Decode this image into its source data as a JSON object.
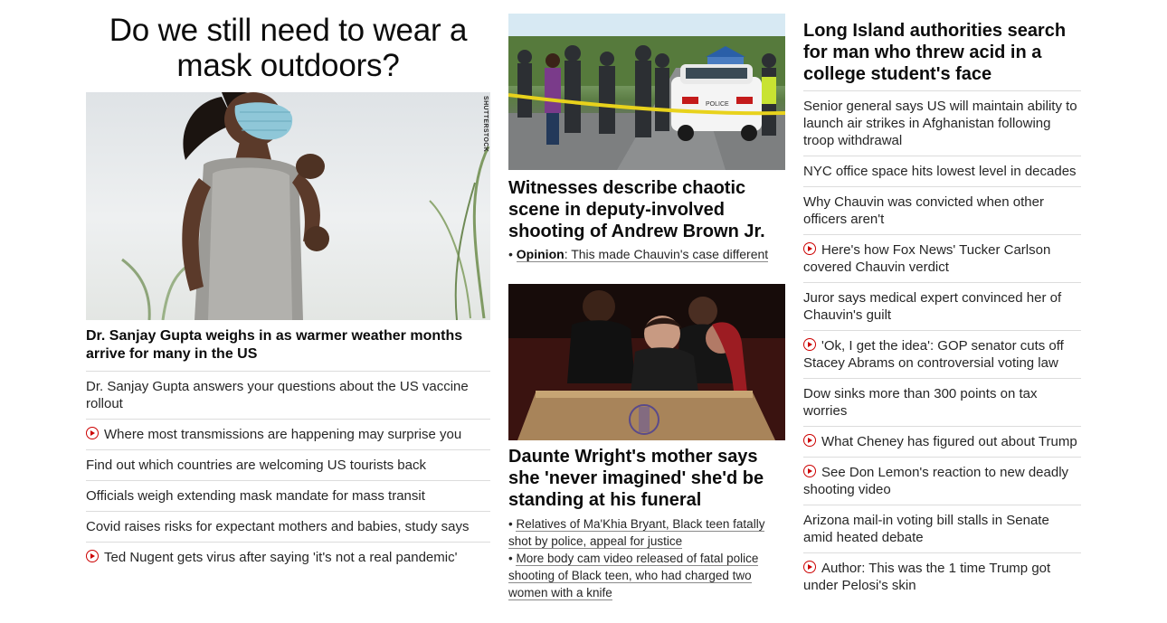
{
  "col1": {
    "headline": "Do we still need to wear a mask outdoors?",
    "image_credit": "SHUTTERSTOCK",
    "image_headline": "Dr. Sanjay Gupta weighs in as warmer weather months arrive for many in the US",
    "items": [
      {
        "text": "Dr. Sanjay Gupta answers your questions about the US vaccine rollout",
        "video": false
      },
      {
        "text": "Where most transmissions are happening may surprise you",
        "video": true
      },
      {
        "text": "Find out which countries are welcoming US tourists back",
        "video": false
      },
      {
        "text": "Officials weigh extending mask mandate for mass transit",
        "video": false
      },
      {
        "text": "Covid raises risks for expectant mothers and babies, study says",
        "video": false
      },
      {
        "text": "Ted Nugent gets virus after saying 'it's not a real pandemic'",
        "video": true
      }
    ]
  },
  "col2": {
    "story1": {
      "headline": "Witnesses describe chaotic scene in deputy-involved shooting of Andrew Brown Jr.",
      "sub_label": "Opinion",
      "sub_text": ": This made Chauvin's case different",
      "police_text": "POLICE"
    },
    "story2": {
      "headline": "Daunte Wright's mother says she 'never imagined' she'd be standing at his funeral",
      "links": [
        "Relatives of Ma'Khia Bryant, Black teen fatally shot by police, appeal for justice",
        "More body cam video released of fatal police shooting of Black teen, who had charged two women with a knife"
      ]
    }
  },
  "col3": {
    "headline": "Long Island authorities search for man who threw acid in a college student's face",
    "items": [
      {
        "text": "Senior general says US will maintain ability to launch air strikes in Afghanistan following troop withdrawal",
        "video": false
      },
      {
        "text": "NYC office space hits lowest level in decades",
        "video": false
      },
      {
        "text": "Why Chauvin was convicted when other officers aren't",
        "video": false
      },
      {
        "text": "Here's how Fox News' Tucker Carlson covered Chauvin verdict",
        "video": true
      },
      {
        "text": "Juror says medical expert convinced her of Chauvin's guilt",
        "video": false
      },
      {
        "text": "'Ok, I get the idea': GOP senator cuts off Stacey Abrams on controversial voting law",
        "video": true
      },
      {
        "text": "Dow sinks more than 300 points on tax worries",
        "video": false
      },
      {
        "text": "What Cheney has figured out about Trump",
        "video": true
      },
      {
        "text": "See Don Lemon's reaction to new deadly shooting video",
        "video": true
      },
      {
        "text": "Arizona mail-in voting bill stalls in Senate amid heated debate",
        "video": false
      },
      {
        "text": "Author: This was the 1 time Trump got under Pelosi's skin",
        "video": true
      }
    ]
  },
  "colors": {
    "video_icon": "#cc0000",
    "divider": "#dcdcdc",
    "text": "#0c0c0c"
  }
}
